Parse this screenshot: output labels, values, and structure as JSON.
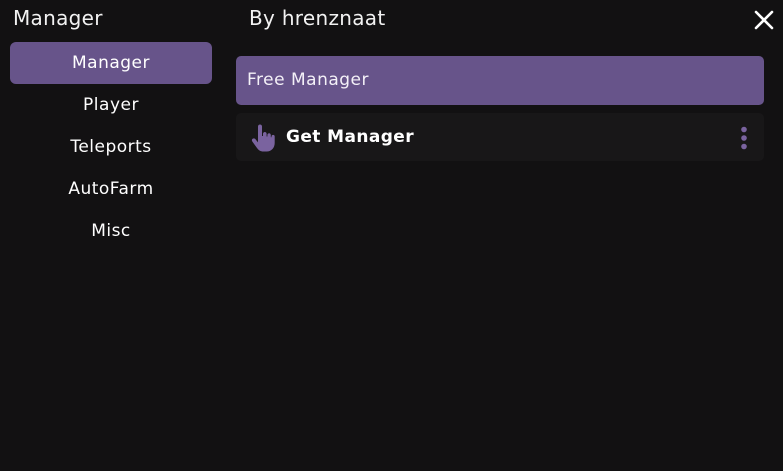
{
  "window": {
    "title": "Manager",
    "subtitle": "By hrenznaat",
    "close_icon": "close-icon"
  },
  "sidebar": {
    "items": [
      {
        "label": "Manager",
        "active": true
      },
      {
        "label": "Player",
        "active": false
      },
      {
        "label": "Teleports",
        "active": false
      },
      {
        "label": "AutoFarm",
        "active": false
      },
      {
        "label": "Misc",
        "active": false
      }
    ]
  },
  "main": {
    "section_title": "Free Manager",
    "buttons": [
      {
        "label": "Get Manager",
        "icon": "pointer-hand-icon",
        "menu_icon": "more-vertical-icon"
      }
    ]
  },
  "colors": {
    "background": "#121112",
    "accent": "#67548a",
    "row_background": "#181718",
    "icon_accent": "#7a639f"
  }
}
